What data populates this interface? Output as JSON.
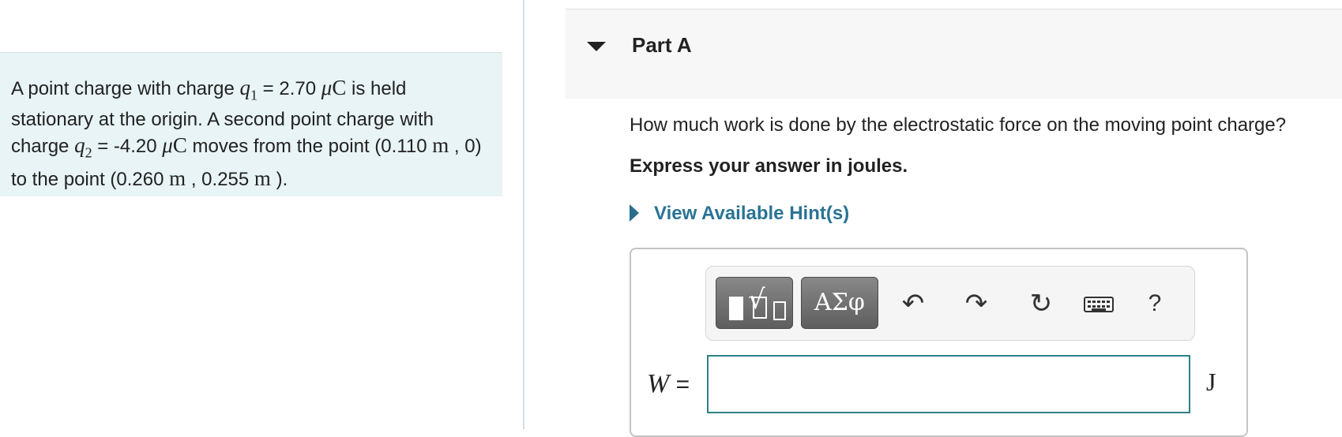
{
  "problem": {
    "t1": "A point charge with charge ",
    "q1_sym": "q",
    "q1_sub": "1",
    "t2": " = 2.70 ",
    "unit_mu": "μ",
    "unit_c": "C",
    "t3": " is held stationary at the origin. A second point charge with charge ",
    "q2_sym": "q",
    "q2_sub": "2",
    "t4": " = -4.20 ",
    "t5": " moves from the point (0.110 ",
    "unit_m": "m",
    "t6": " , 0) to the point (0.260 ",
    "t7": " , 0.255 ",
    "t8": " )."
  },
  "part": {
    "title": "Part A"
  },
  "question": "How much work is done by the electrostatic force on the moving point charge?",
  "instruction": "Express your answer in joules.",
  "hint": {
    "label": "View Available Hint(s)"
  },
  "toolbar": {
    "greek_label": "ΑΣφ",
    "undo_glyph": "↶",
    "redo_glyph": "↷",
    "reset_glyph": "↻",
    "help_label": "?"
  },
  "answer": {
    "variable": "W",
    "equals": "=",
    "value": "",
    "unit": "J"
  }
}
